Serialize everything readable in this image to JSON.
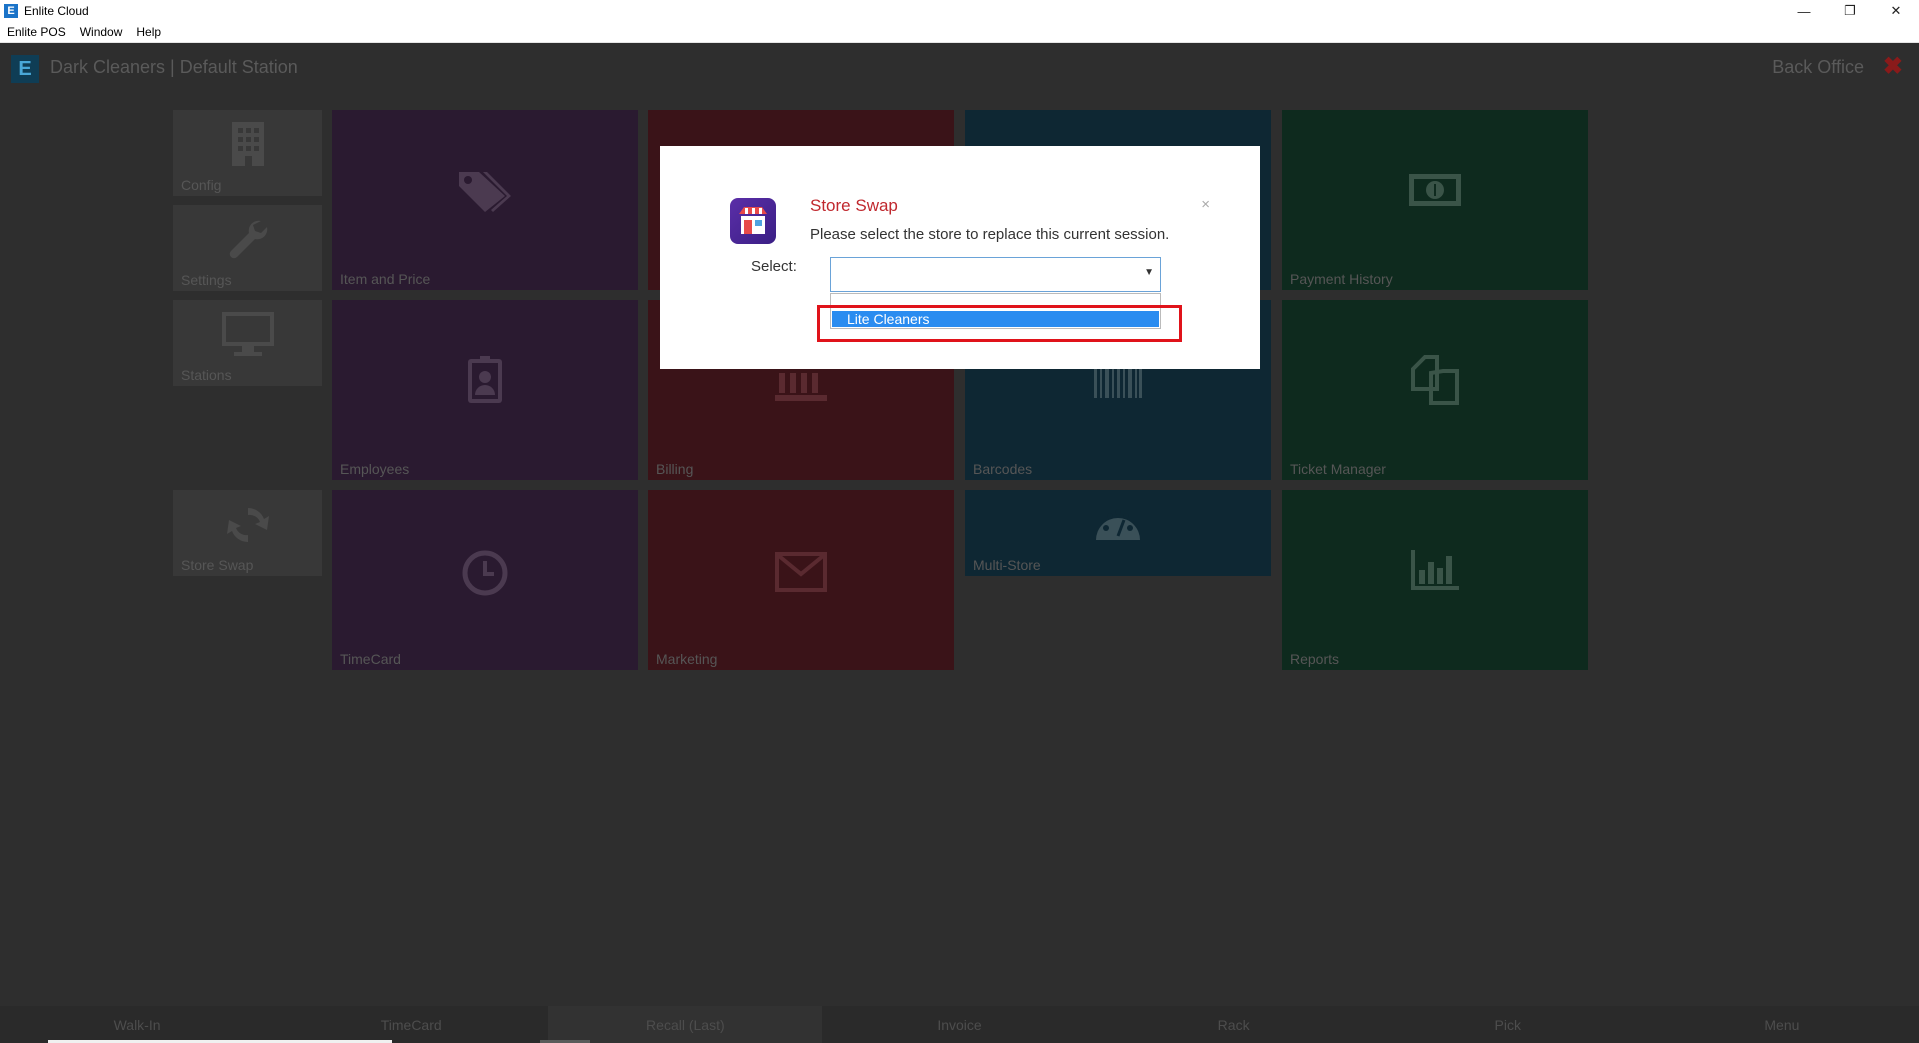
{
  "window": {
    "title": "Enlite Cloud",
    "app_icon_letter": "E",
    "controls": {
      "minimize": "—",
      "restore": "❐",
      "close": "✕"
    }
  },
  "menu": [
    "Enlite POS",
    "Window",
    "Help"
  ],
  "header": {
    "brand_letter": "E",
    "station": "Dark Cleaners | Default Station",
    "back_office": "Back Office",
    "close_symbol": "✖"
  },
  "tiles": {
    "config": "Config",
    "settings": "Settings",
    "stations": "Stations",
    "store_swap": "Store Swap",
    "item_price": "Item and Price",
    "payment_history": "Payment History",
    "employees": "Employees",
    "billing": "Billing",
    "barcodes": "Barcodes",
    "ticket_manager": "Ticket Manager",
    "timecard": "TimeCard",
    "marketing": "Marketing",
    "multi_store": "Multi-Store",
    "reports": "Reports"
  },
  "dialog": {
    "title": "Store Swap",
    "subtitle": "Please select the store to replace this current session.",
    "close": "×",
    "select_label": "Select:",
    "select_value": "",
    "arrow": "▼",
    "options": [
      "Lite Cleaners"
    ]
  },
  "bottom_bar": [
    "Walk-In",
    "TimeCard",
    "Recall (Last)",
    "Invoice",
    "Rack",
    "Pick",
    "Menu"
  ],
  "colors": {
    "highlight": "#e0131a",
    "dialog_title": "#c0282e",
    "selected_option": "#2a8cf0"
  }
}
